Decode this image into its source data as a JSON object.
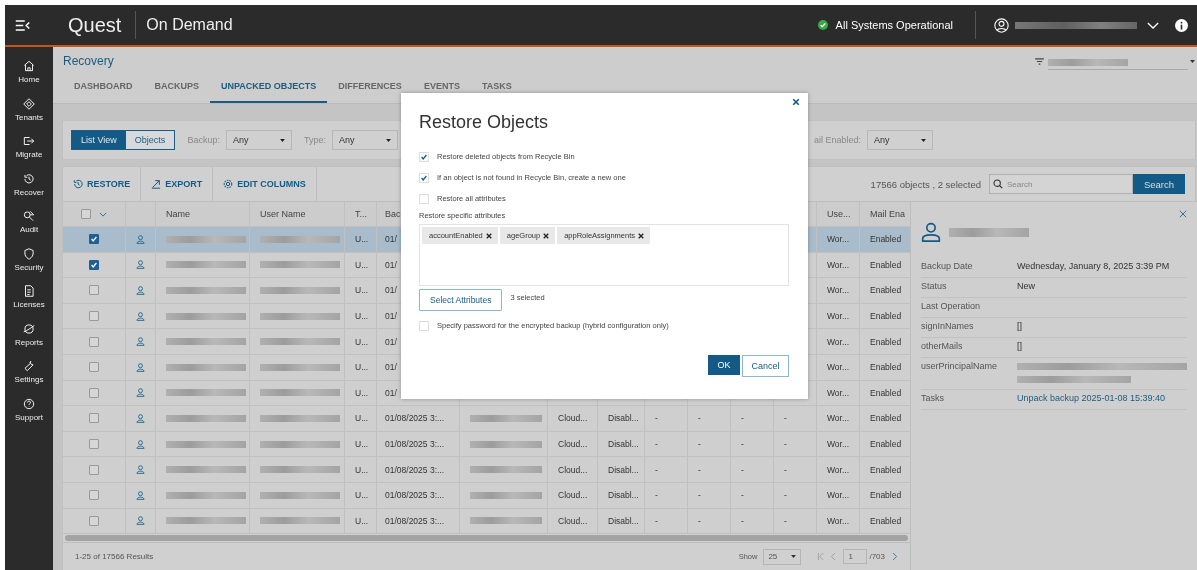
{
  "topbar": {
    "logo": "Quest",
    "product": "On Demand",
    "status": "All Systems Operational"
  },
  "sidebar": {
    "items": [
      {
        "label": "Home"
      },
      {
        "label": "Tenants"
      },
      {
        "label": "Migrate"
      },
      {
        "label": "Recover"
      },
      {
        "label": "Audit"
      },
      {
        "label": "Security"
      },
      {
        "label": "Licenses"
      },
      {
        "label": "Reports"
      },
      {
        "label": "Settings"
      },
      {
        "label": "Support"
      }
    ]
  },
  "page": {
    "title": "Recovery",
    "tabs": [
      {
        "label": "DASHBOARD",
        "selected": false
      },
      {
        "label": "BACKUPS",
        "selected": false
      },
      {
        "label": "UNPACKED OBJECTS",
        "selected": true
      },
      {
        "label": "DIFFERENCES",
        "selected": false
      },
      {
        "label": "EVENTS",
        "selected": false
      },
      {
        "label": "TASKS",
        "selected": false
      }
    ]
  },
  "filters": {
    "views": [
      {
        "label": "List View",
        "selected": true
      },
      {
        "label": "Objects",
        "selected": false
      }
    ],
    "fields": [
      {
        "label": "Backup:",
        "value": "Any"
      },
      {
        "label": "Type:",
        "value": "Any"
      },
      {
        "label": "ail Enabled:",
        "value": "Any"
      }
    ]
  },
  "toolbar": {
    "actions": [
      {
        "label": "RESTORE"
      },
      {
        "label": "EXPORT"
      },
      {
        "label": "EDIT COLUMNS"
      }
    ],
    "count": "17566 objects , 2 selected",
    "search": {
      "placeholder": "Search",
      "button": "Search"
    }
  },
  "table": {
    "check_all": false,
    "columns": {
      "name": "Name",
      "user_name": "User Name",
      "type": "T...",
      "backup": "Bac",
      "user_type": "Use...",
      "mail_enabled": "Mail Ena"
    },
    "rows": [
      {
        "selected": true,
        "checked": true,
        "type": "U...",
        "backup": "01/",
        "user_type": "Wor...",
        "mail_enabled": "Enabled"
      },
      {
        "selected": false,
        "checked": true,
        "type": "U...",
        "backup": "01/",
        "user_type": "Wor...",
        "mail_enabled": "Enabled"
      },
      {
        "selected": false,
        "checked": false,
        "type": "U...",
        "backup": "01/",
        "user_type": "Wor...",
        "mail_enabled": "Enabled"
      },
      {
        "selected": false,
        "checked": false,
        "type": "U...",
        "backup": "01/",
        "user_type": "Wor...",
        "mail_enabled": "Enabled"
      },
      {
        "selected": false,
        "checked": false,
        "type": "U...",
        "backup": "01/",
        "user_type": "Wor...",
        "mail_enabled": "Enabled"
      },
      {
        "selected": false,
        "checked": false,
        "type": "U...",
        "backup": "01/",
        "user_type": "Wor...",
        "mail_enabled": "Enabled"
      },
      {
        "selected": false,
        "checked": false,
        "type": "U...",
        "backup": "01/",
        "user_type": "Wor...",
        "mail_enabled": "Enabled"
      },
      {
        "selected": false,
        "checked": false,
        "type": "U...",
        "backup": "01/08/2025 3:...",
        "column_7": "Cloud...",
        "column_8": "Disabl...",
        "column_9": "-",
        "column_10": "-",
        "column_11": "-",
        "column_12": "-",
        "user_type": "Wor...",
        "mail_enabled": "Enabled"
      },
      {
        "selected": false,
        "checked": false,
        "type": "U...",
        "backup": "01/08/2025 3:...",
        "column_7": "Cloud...",
        "column_8": "Disabl...",
        "column_9": "-",
        "column_10": "-",
        "column_11": "-",
        "column_12": "-",
        "user_type": "Wor...",
        "mail_enabled": "Enabled"
      },
      {
        "selected": false,
        "checked": false,
        "type": "U...",
        "backup": "01/08/2025 3:...",
        "column_7": "Cloud...",
        "column_8": "Disabl...",
        "column_9": "-",
        "column_10": "-",
        "column_11": "-",
        "column_12": "-",
        "user_type": "Wor...",
        "mail_enabled": "Enabled"
      },
      {
        "selected": false,
        "checked": false,
        "type": "U...",
        "backup": "01/08/2025 3:...",
        "column_7": "Cloud...",
        "column_8": "Disabl...",
        "column_9": "-",
        "column_10": "-",
        "column_11": "-",
        "column_12": "-",
        "user_type": "Wor...",
        "mail_enabled": "Enabled"
      },
      {
        "selected": false,
        "checked": false,
        "type": "U...",
        "backup": "01/08/2025 3:...",
        "column_7": "Cloud...",
        "column_8": "Disabl...",
        "column_9": "-",
        "column_10": "-",
        "column_11": "-",
        "column_12": "-",
        "user_type": "Wor...",
        "mail_enabled": "Enabled"
      }
    ]
  },
  "footer": {
    "results": "1-25 of 17566 Results",
    "show_label": "Show",
    "page_size": "25",
    "page": "1",
    "pages": "/703"
  },
  "details": {
    "fields": [
      {
        "label": "Backup Date",
        "kind": "text",
        "value": "Wednesday, January 8, 2025 3:39 PM"
      },
      {
        "label": "Status",
        "kind": "text",
        "value": "New"
      },
      {
        "label": "Last Operation",
        "kind": "text"
      },
      {
        "label": "signInNames",
        "kind": "text",
        "value": "[]"
      },
      {
        "label": "otherMails",
        "kind": "text",
        "value": "[]"
      },
      {
        "label": "userPrincipalName",
        "kind": "blurred"
      },
      {
        "label": "Tasks",
        "kind": "link",
        "value": "Unpack backup 2025-01-08 15:39:40"
      }
    ]
  },
  "dialog": {
    "title": "Restore Objects",
    "options": [
      {
        "label": "Restore deleted objects from Recycle Bin",
        "checked": true
      },
      {
        "label": "If an object is not found in Recycle Bin, create a new one",
        "checked": true
      },
      {
        "label": "Restore all attributes",
        "checked": false
      }
    ],
    "attributes_label": "Restore specific attributes",
    "attributes": [
      "accountEnabled",
      "ageGroup",
      "appRoleAssignments"
    ],
    "select_button": "Select Attributes",
    "selected_count": "3 selected",
    "password_option": {
      "label": "Specify password for the encrypted backup (hybrid configuration only)",
      "checked": false
    },
    "ok": "OK",
    "cancel": "Cancel"
  }
}
